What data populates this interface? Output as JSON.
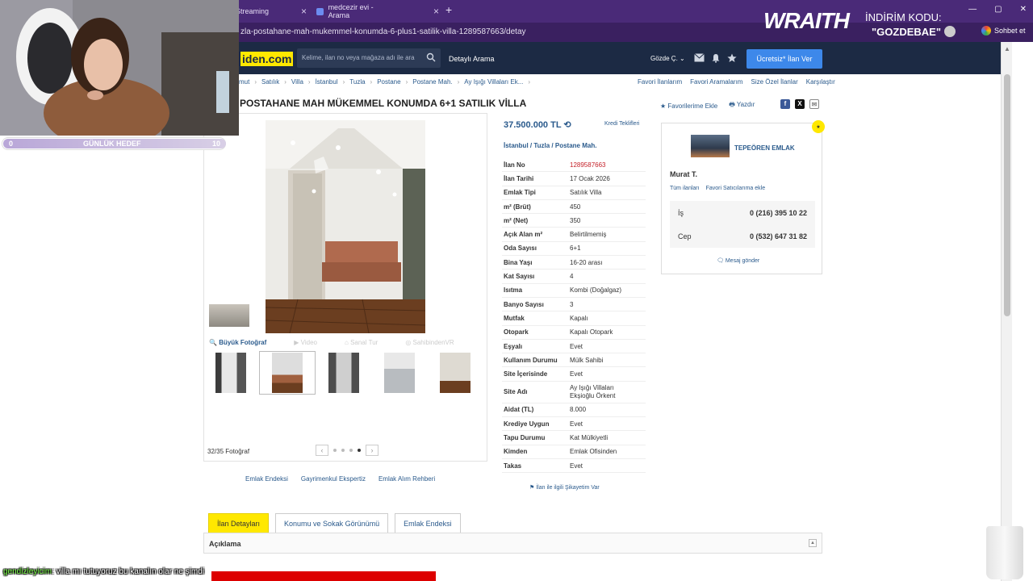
{
  "browser": {
    "tabs": [
      {
        "title": "Streaming",
        "active": true
      },
      {
        "title": "medcezir evi - Arama",
        "active": false
      }
    ],
    "address": "zla-postahane-mah-mukemmel-konumda-6-plus1-satilik-villa-1289587663/detay",
    "window_controls": [
      "—",
      "▢",
      "✕"
    ]
  },
  "overlay": {
    "brand": "WRAITH",
    "code_label": "İNDİRİM KODU:",
    "code_value": "\"GOZDEBAE\"",
    "chat_button": "Sohbet et",
    "goal": {
      "start": "0",
      "label": "GÜNLÜK HEDEF",
      "end": "10",
      "progress_fraction": 0.0
    },
    "chat_nick": "gendizleyicim",
    "chat_message": ": villa mı tutuyoruz bu kanalın olar ne şimdi"
  },
  "header": {
    "logo": "iden.com",
    "search_placeholder": "Kelime, ilan no veya mağaza adı ile ara",
    "detailed_search": "Detaylı Arama",
    "user": "Gözde Ç.",
    "post_button": "Ücretsiz* İlan Ver"
  },
  "breadcrumb": [
    "mut",
    "Satılık",
    "Villa",
    "İstanbul",
    "Tuzla",
    "Postane",
    "Postane Mah.",
    "Ay Işığı Villaları Ek..."
  ],
  "top_links": [
    "Favori İlanlarım",
    "Favori Aramalarım",
    "Size Özel İlanlar",
    "Karşılaştır"
  ],
  "listing": {
    "title": "POSTAHANE MAH MÜKEMMEL KONUMDA 6+1 SATILIK VİLLA",
    "fav_label": "Favorilerime Ekle",
    "print_label": "Yazdır",
    "price": "37.500.000 TL",
    "credit_link": "Kredi Teklifleri",
    "location": [
      "İstanbul",
      "Tuzla",
      "Postane Mah."
    ],
    "specs": [
      {
        "k": "İlan No",
        "v": "1289587663"
      },
      {
        "k": "İlan Tarihi",
        "v": "17 Ocak 2026"
      },
      {
        "k": "Emlak Tipi",
        "v": "Satılık Villa"
      },
      {
        "k": "m² (Brüt)",
        "v": "450"
      },
      {
        "k": "m² (Net)",
        "v": "350"
      },
      {
        "k": "Açık Alan m²",
        "v": "Belirtilmemiş"
      },
      {
        "k": "Oda Sayısı",
        "v": "6+1"
      },
      {
        "k": "Bina Yaşı",
        "v": "16-20 arası"
      },
      {
        "k": "Kat Sayısı",
        "v": "4"
      },
      {
        "k": "Isıtma",
        "v": "Kombi (Doğalgaz)"
      },
      {
        "k": "Banyo Sayısı",
        "v": "3"
      },
      {
        "k": "Mutfak",
        "v": "Kapalı"
      },
      {
        "k": "Otopark",
        "v": "Kapalı Otopark"
      },
      {
        "k": "Eşyalı",
        "v": "Evet"
      },
      {
        "k": "Kullanım Durumu",
        "v": "Mülk Sahibi"
      },
      {
        "k": "Site İçerisinde",
        "v": "Evet"
      },
      {
        "k": "Site Adı",
        "v": "Ay Işığı Villaları Ekşioğlu Örkent"
      },
      {
        "k": "Aidat (TL)",
        "v": "8.000"
      },
      {
        "k": "Krediye Uygun",
        "v": "Evet"
      },
      {
        "k": "Tapu Durumu",
        "v": "Kat Mülkiyetli"
      },
      {
        "k": "Kimden",
        "v": "Emlak Ofisinden"
      },
      {
        "k": "Takas",
        "v": "Evet"
      }
    ],
    "complaint": "İlan ile ilgili Şikayetim Var"
  },
  "gallery": {
    "tabs": [
      "Büyük Fotoğraf",
      "Video",
      "Sanal Tur",
      "SahibindenVR"
    ],
    "count": "32/35 Fotoğraf",
    "pager_prev": "‹",
    "pager_next": "›"
  },
  "under_links": [
    "Emlak Endeksi",
    "Gayrimenkul Ekspertiz",
    "Emlak Alım Rehberi"
  ],
  "seller": {
    "store": "TEPEÖREN EMLAK",
    "agent": "Murat T.",
    "links": [
      "Tüm ilanları",
      "Favori Satıcılarıma ekle"
    ],
    "phones": [
      {
        "label": "İş",
        "num": "0 (216) 395 10 22"
      },
      {
        "label": "Cep",
        "num": "0 (532) 647 31 82"
      }
    ],
    "message": "Mesaj gönder"
  },
  "bottom_tabs": [
    "İlan Detayları",
    "Konumu ve Sokak Görünümü",
    "Emlak Endeksi"
  ],
  "description_label": "Açıklama",
  "colors": {
    "brand_yellow": "#ffe800",
    "header_navy": "#1c2a44",
    "link_blue": "#2a5a8c",
    "browser_purple": "#4a2a78"
  }
}
